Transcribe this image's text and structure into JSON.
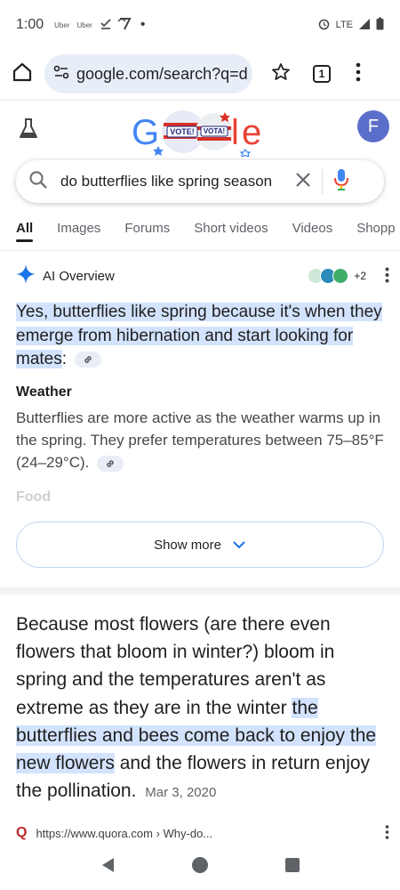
{
  "status_bar": {
    "time": "1:00",
    "notifications": [
      "Uber",
      "Uber"
    ],
    "network": "LTE"
  },
  "browser": {
    "url": "google.com/search?q=d",
    "tab_count": "1"
  },
  "profile": {
    "initial": "F",
    "color": "#5b6ec9"
  },
  "doodle": {
    "badge_left": "VOTE!",
    "badge_right": "VOTA!"
  },
  "search": {
    "query": "do butterflies like spring season"
  },
  "tabs": [
    "All",
    "Images",
    "Forums",
    "Short videos",
    "Videos",
    "Shopp"
  ],
  "ai_overview": {
    "label": "AI Overview",
    "source_count": "+2",
    "answer_highlight": "Yes, butterflies like spring because it's when they emerge from hibernation and start looking for mates",
    "answer_tail": ":",
    "section_title": "Weather",
    "section_body": "Butterflies are more active as the weather warms up in the spring. They prefer temperatures between 75–85°F (24–29°C).",
    "faded_next_title": "Food",
    "show_more": "Show more"
  },
  "result": {
    "snippet_before": "Because most flowers (are there even flowers that bloom in winter?) bloom in spring and the temperatures aren't as extreme as they are in the winter ",
    "snippet_highlight": "the butterflies and bees come back to enjoy the new flowers",
    "snippet_after": " and the flowers in return enjoy the pollination.",
    "date": "Mar 3, 2020",
    "favicon": "Q",
    "source_url": "https://www.quora.com › Why-do..."
  },
  "colors": {
    "highlight": "#d3e3fd",
    "accent_blue": "#1a73e8",
    "quora_red": "#b92b27"
  }
}
